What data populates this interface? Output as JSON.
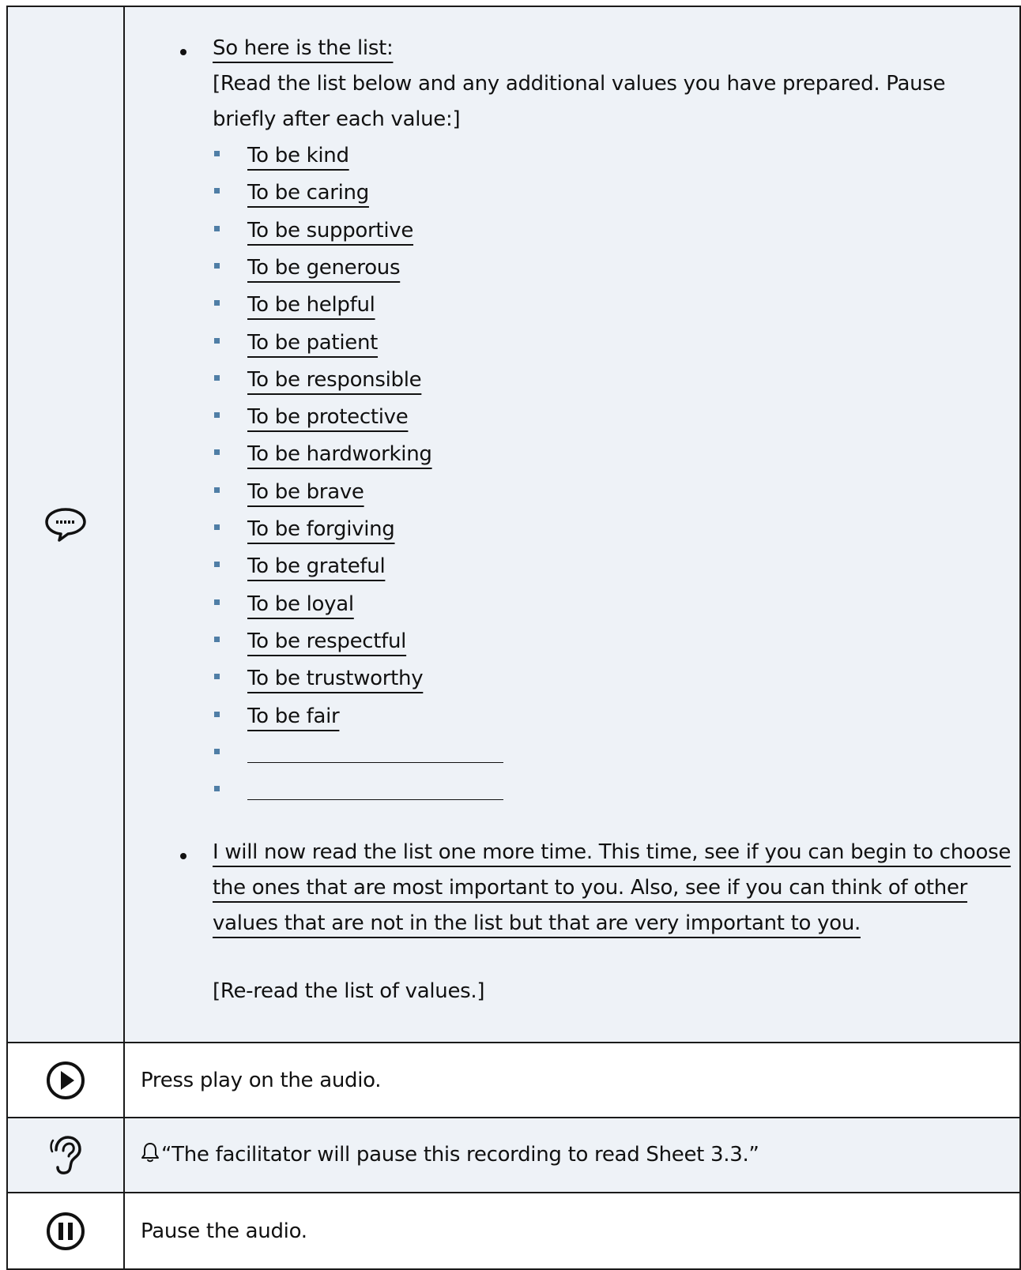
{
  "main": {
    "intro": "So here is the list:",
    "instruction": "[Read the list below and any additional values you have prepared. Pause briefly after each value:]",
    "values": [
      "To be kind",
      "To be caring",
      "To be supportive",
      "To be generous",
      "To be helpful",
      "To be patient",
      "To be responsible",
      "To be protective",
      "To be hardworking",
      "To be brave",
      "To be forgiving",
      "To be grateful",
      "To be loyal",
      "To be respectful",
      "To be trustworthy",
      "To be fair"
    ],
    "blank_count": 2,
    "reread_para": "I will now read the list one more time. This time, see if you can begin to choose the ones that are most important to you. Also, see if you can think of other values that are not in the list but that are very important to you.",
    "reread_note": "[Re-read the list of values.]"
  },
  "rows": {
    "play": "Press play on the audio.",
    "listen": "“The facilitator will pause this recording to read Sheet 3.3.”",
    "pause": "Pause the audio."
  },
  "icons": {
    "speak": "speech-bubble-icon",
    "play": "play-icon",
    "listen": "ear-icon",
    "bell": "bell-icon",
    "pause": "pause-icon"
  },
  "colors": {
    "shade": "#eef2f7",
    "sub_bullet": "#4f7ea6",
    "border": "#1a1a1a"
  }
}
